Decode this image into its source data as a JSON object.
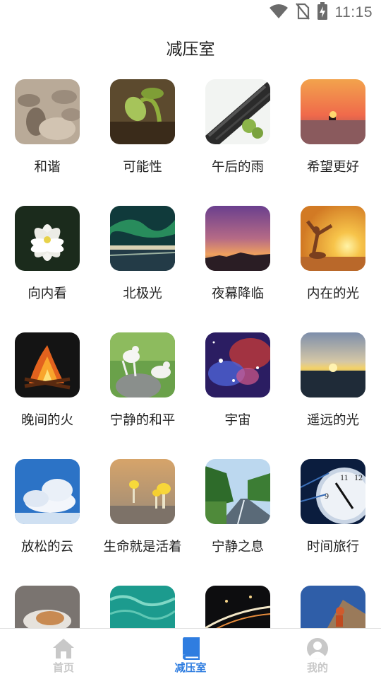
{
  "status_bar": {
    "time": "11:15",
    "icons": [
      "wifi-icon",
      "no-sim-icon",
      "battery-charging-icon"
    ]
  },
  "page": {
    "title": "减压室"
  },
  "tiles": [
    {
      "label": "和谐",
      "image": "stacked-stones"
    },
    {
      "label": "可能性",
      "image": "seedling-sprout"
    },
    {
      "label": "午后的雨",
      "image": "roof-tiles-rain"
    },
    {
      "label": "希望更好",
      "image": "sunset-sea-boat"
    },
    {
      "label": "向内看",
      "image": "white-lotus"
    },
    {
      "label": "北极光",
      "image": "aurora-over-town"
    },
    {
      "label": "夜幕降临",
      "image": "purple-dusk-sky"
    },
    {
      "label": "内在的光",
      "image": "woman-sunrise"
    },
    {
      "label": "晚间的火",
      "image": "campfire"
    },
    {
      "label": "宁静的和平",
      "image": "white-doves"
    },
    {
      "label": "宇宙",
      "image": "nebula"
    },
    {
      "label": "遥远的光",
      "image": "distant-sunset"
    },
    {
      "label": "放松的云",
      "image": "blue-sky-clouds"
    },
    {
      "label": "生命就是活着",
      "image": "yellow-mushrooms"
    },
    {
      "label": "宁静之息",
      "image": "tree-lined-road"
    },
    {
      "label": "时间旅行",
      "image": "clock-face"
    },
    {
      "label": "",
      "image": "sleeping-cat"
    },
    {
      "label": "",
      "image": "turquoise-water"
    },
    {
      "label": "",
      "image": "night-city-traffic"
    },
    {
      "label": "",
      "image": "climber-on-rock"
    }
  ],
  "bottom_nav": {
    "items": [
      {
        "label": "首页",
        "icon": "home-icon",
        "active": false
      },
      {
        "label": "减压室",
        "icon": "book-icon",
        "active": true
      },
      {
        "label": "我的",
        "icon": "profile-icon",
        "active": false
      }
    ],
    "active_color": "#2f7de0",
    "inactive_color": "#c8c8c8"
  }
}
